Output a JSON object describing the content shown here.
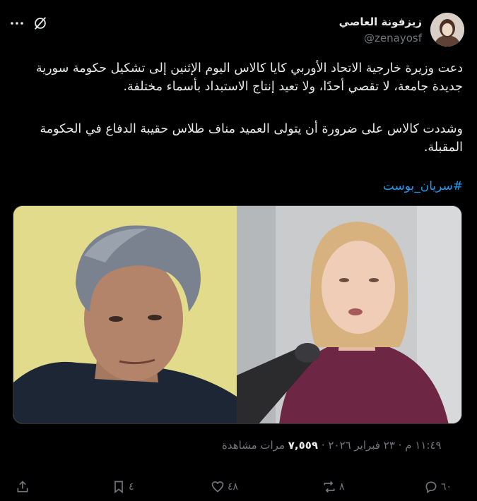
{
  "author": {
    "name": "زيزفونة العاصي",
    "handle": "@zenayosf"
  },
  "tweet": {
    "paragraph1": "دعت وزيرة خارجية الاتحاد الأوربي كايا كالاس اليوم الإثنين إلى تشكيل حكومة سورية جديدة جامعة، لا تقصي أحدًا، ولا تعيد إنتاج الاستبداد بأسماء مختلفة.",
    "paragraph2": "وشددت كالاس على ضرورة أن يتولى العميد مناف طلاس حقيبة الدفاع في الحكومة المقبلة.",
    "hashtag": "#سريان_بوست"
  },
  "meta": {
    "time": "١١:٤٩ م",
    "separator1": " · ",
    "date": "٢٣ فبراير ٢٠٢٦",
    "separator2": " · ",
    "views": "٧,٥٥٩",
    "views_label": " مرات مشاهدة"
  },
  "actions": {
    "replies": "٦٠",
    "reposts": "٨",
    "likes": "٤٨",
    "bookmarks": "٤"
  },
  "colors": {
    "background": "#000000",
    "text": "#e7e9ea",
    "muted": "#71767b",
    "link": "#1d9bf0"
  }
}
